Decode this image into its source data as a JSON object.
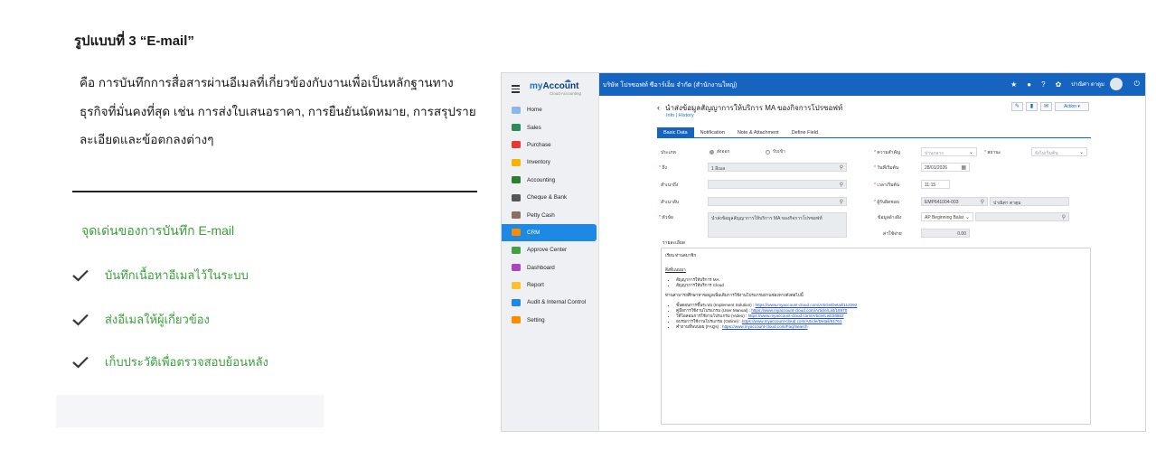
{
  "article": {
    "heading": "รูปแบบที่ 3 “E-mail”",
    "description": "คือ การบันทึกการสื่อสารผ่านอีเมลที่เกี่ยวข้องกับงานเพื่อเป็นหลักฐานทางธุรกิจที่มั่นคงที่สุด เช่น การส่งใบเสนอราคา, การยืนยันนัดหมาย, การสรุปรายละเอียดและข้อตกลงต่างๆ",
    "features_title": "จุดเด่นของการบันทึก E-mail",
    "features": [
      "บันทึกเนื้อหาอีเมลไว้ในระบบ",
      "ส่งอีเมลให้ผู้เกี่ยวข้อง",
      "เก็บประวัติเพื่อตรวจสอบย้อนหลัง"
    ],
    "accent_color": "#3aa03a"
  },
  "app": {
    "logo": {
      "brand_a": "my",
      "brand_b": "Account",
      "sub": "Cloud Accounting"
    },
    "company": "บริษัท โปรซอฟท์ ซีอาร์เอ็ม จำกัด (สำนักงานใหญ่)",
    "user": "ปาณิศา ตาตูม",
    "topbar_color": "#1565c0",
    "nav": [
      {
        "label": "Home",
        "icon": "home-icon",
        "color": "#8fb7e6"
      },
      {
        "label": "Sales",
        "icon": "sales-icon",
        "color": "#2e8b57"
      },
      {
        "label": "Purchase",
        "icon": "cart-icon",
        "color": "#e53935"
      },
      {
        "label": "Inventory",
        "icon": "box-icon",
        "color": "#f4b400"
      },
      {
        "label": "Accounting",
        "icon": "ledger-icon",
        "color": "#2e7d32"
      },
      {
        "label": "Cheque & Bank",
        "icon": "bank-icon",
        "color": "#555555"
      },
      {
        "label": "Petty Cash",
        "icon": "wallet-icon",
        "color": "#8d6e63"
      },
      {
        "label": "CRM",
        "icon": "crm-icon",
        "color": "#fb8c00"
      },
      {
        "label": "Approve Center",
        "icon": "approve-icon",
        "color": "#43a047"
      },
      {
        "label": "Dashboard",
        "icon": "dashboard-icon",
        "color": "#ab47bc"
      },
      {
        "label": "Report",
        "icon": "report-icon",
        "color": "#fbc02d"
      },
      {
        "label": "Audit & Internal Control",
        "icon": "audit-icon",
        "color": "#1e88e5"
      },
      {
        "label": "Setting",
        "icon": "setting-icon",
        "color": "#fb8c00"
      }
    ],
    "active_nav": "CRM",
    "doc": {
      "title": "นำส่งข้อมูลสัญญาการให้บริการ MA ของกิจการโปรซอฟท์",
      "links": "Info | History",
      "action_label": "Action"
    },
    "tabs": [
      "Basic Data",
      "Notification",
      "Note & Attachment",
      "Define Field"
    ],
    "form": {
      "type_label": "ประเภท",
      "radio_send": "ส่งออก",
      "radio_receive": "รับเข้า",
      "to_label": "ถึง",
      "to_value": "1 อีเมล",
      "cc_label": "สำเนาถึง",
      "bcc_label": "สำเนาลับ",
      "subject_label": "หัวข้อ",
      "subject_value": "นำส่งข้อมูลสัญญาการให้บริการ MA ของกิจการโปรซอฟท์",
      "priority_label": "ความสำคัญ",
      "priority_value": "ปานกลาง",
      "status_label": "สถานะ",
      "status_value": "ยังไม่เริ่มต้น",
      "start_date_label": "วันที่เริ่มต้น",
      "start_date_value": "28/01/2026",
      "start_time_label": "เวลาเริ่มต้น",
      "start_time_value": "11:15",
      "owner_label": "ผู้รับผิดชอบ",
      "owner_code": "EMP641004-003",
      "owner_name": "ปาณิศา ตาตูม",
      "ref_label": "ข้อมูลอ้างอิง",
      "ref_value": "AP Beginning Balar",
      "cost_label": "ค่าใช้จ่าย",
      "cost_value": "0.00"
    },
    "detail": {
      "label": "รายละเอียด",
      "greeting": "เรียน ท่านสมาชิก",
      "section1": "สิ่งที่แนบมา",
      "items1": [
        "สัญญาการให้บริการ MA",
        "สัญญาการให้บริการ Cloud"
      ],
      "section2": "ท่านสามารถศึกษาหาขอมูลเพิ่มเติมการใช้งานโปรแกรมผ่านช่องทางดังต่อไปนี้",
      "links": [
        {
          "label": "ขั้นตอนการขึ้นระบบ (Implement Solution) : ",
          "url": "https://www.myaccount-cloud.com/Article/Detail/112292"
        },
        {
          "label": "คู่มือการใช้งานโปรแกรม (User Manual) : ",
          "url": "https://www.myaccount-cloud.com/Article/List/16970"
        },
        {
          "label": "วีดีโอสอนการใช้งานโปรแกรม (Video) : ",
          "url": "https://www.myaccount-cloud.com/Article/List/26882"
        },
        {
          "label": "อบรมการใช้งานโปรแกรม (Online) : ",
          "url": "https://www.myaccount-cloud.com/Article/Detail/61761"
        },
        {
          "label": "คำถามที่พบบ่อย (FAQs) : ",
          "url": "https://www.myaccount-cloud.com/Faq/Search"
        }
      ]
    }
  }
}
